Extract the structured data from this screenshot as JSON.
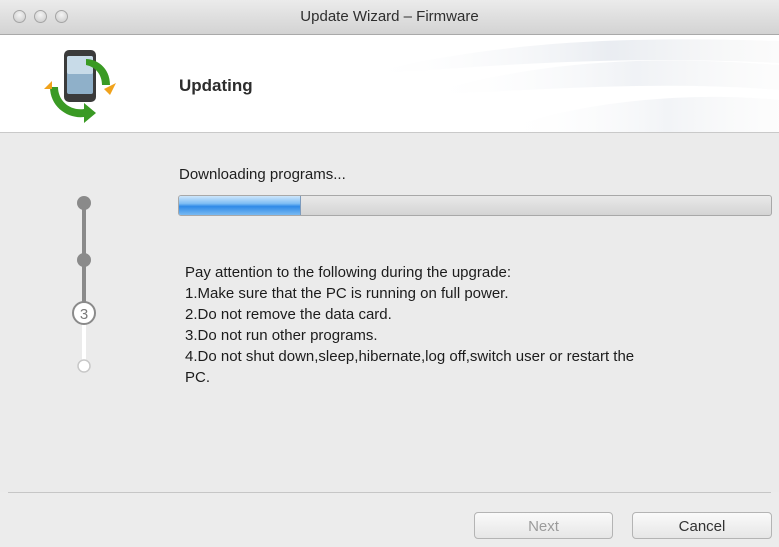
{
  "window": {
    "title": "Update Wizard – Firmware"
  },
  "header": {
    "title": "Updating",
    "logo_icon": "phone-sync-icon"
  },
  "progress": {
    "status": "Downloading programs...",
    "fraction": 0.205
  },
  "steps": {
    "current_step_label": "3",
    "items": [
      "completed",
      "completed",
      "current",
      "pending"
    ]
  },
  "notes": {
    "lines": [
      "Pay attention to the following during the upgrade:",
      "1.Make sure that the PC is running on full power.",
      "2.Do not remove the data card.",
      "3.Do not run other programs.",
      "4.Do not shut down,sleep,hibernate,log off,switch user or restart the",
      "PC."
    ]
  },
  "buttons": {
    "next": "Next",
    "cancel": "Cancel"
  },
  "colors": {
    "progress_fill": "#2f8ae8",
    "logo_green": "#3a9a24",
    "logo_orange": "#f0a21c"
  }
}
